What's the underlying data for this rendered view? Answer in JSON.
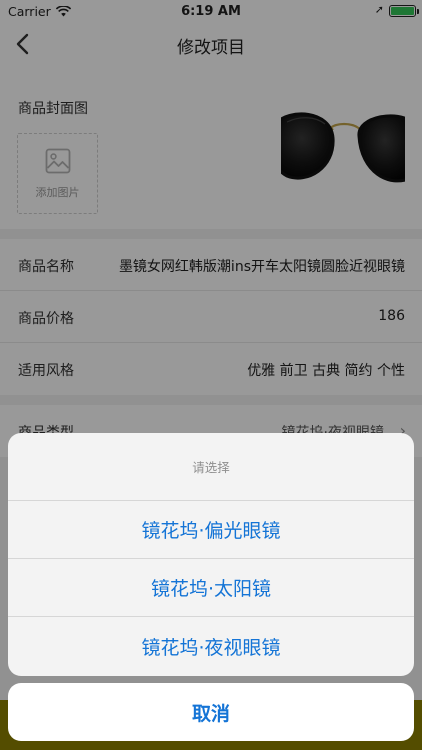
{
  "status_bar": {
    "carrier": "Carrier",
    "time": "6:19 AM"
  },
  "nav": {
    "title": "修改项目"
  },
  "cover": {
    "label": "商品封面图",
    "add_image_label": "添加图片"
  },
  "details": {
    "rows": [
      {
        "label": "商品名称",
        "value": "墨镜女网红韩版潮ins开车太阳镜圆脸近视眼镜"
      },
      {
        "label": "商品价格",
        "value": "186"
      },
      {
        "label": "适用风格",
        "value": "优雅 前卫 古典 简约 个性"
      }
    ]
  },
  "type_row": {
    "label": "商品类型",
    "value": "镜花坞·夜视眼镜"
  },
  "action_sheet": {
    "title": "请选择",
    "options": [
      "镜花坞·偏光眼镜",
      "镜花坞·太阳镜",
      "镜花坞·夜视眼镜"
    ],
    "cancel_label": "取消"
  },
  "colors": {
    "accent": "#1474d6",
    "bottom_bar": "#8c8100",
    "battery": "#35c759"
  }
}
